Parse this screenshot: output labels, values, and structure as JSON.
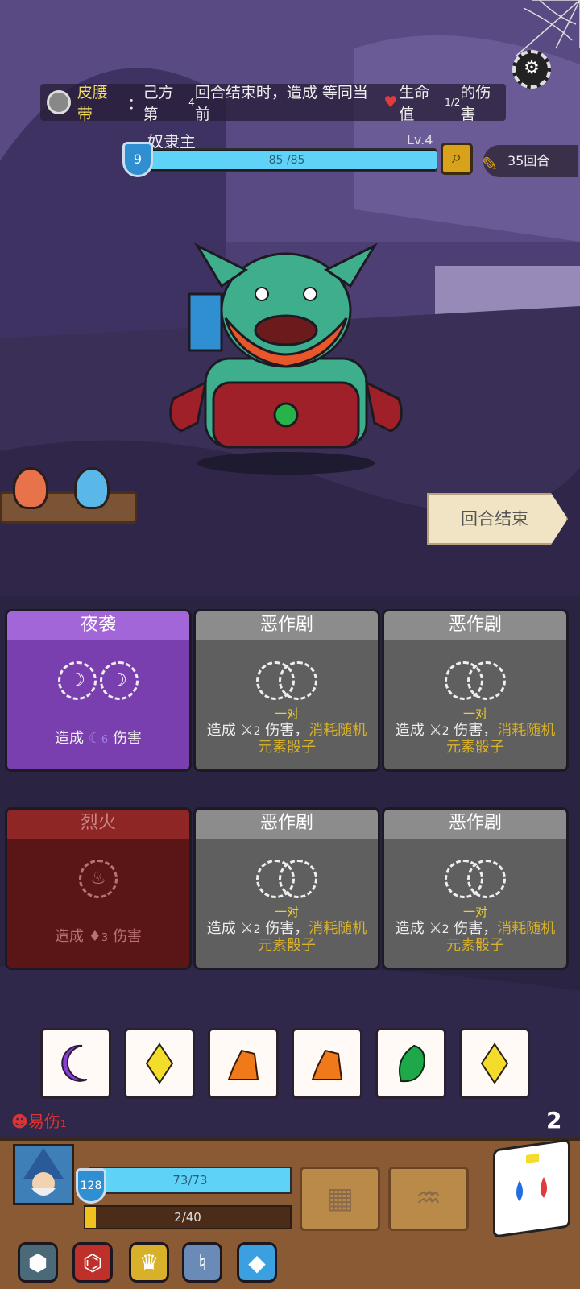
{
  "belt": {
    "name": "皮腰带",
    "sep": "：",
    "text_a": "己方第",
    "num_a": "4",
    "text_b": "回合结束时，造成 等同当前",
    "text_c": "生命值",
    "num_b": "1/2",
    "text_d": " 的伤害"
  },
  "enemy": {
    "name": "奴隶主",
    "level": "Lv.4",
    "shield": "9",
    "hp_text": "85 /85",
    "hp_fraction": 1.0
  },
  "round_label": "35回合",
  "end_turn_label": "回合结束",
  "cards": [
    {
      "title": "夜袭",
      "style": "purple",
      "desc_a": "造成",
      "dmg": "6",
      "desc_b": "伤害"
    },
    {
      "title": "恶作剧",
      "style": "gray",
      "cond": "一对",
      "desc_a": "造成",
      "dmg": "2",
      "desc_b": "伤害，",
      "desc_gold": "消耗随机",
      "desc_gold2": "元素骰子"
    },
    {
      "title": "恶作剧",
      "style": "gray",
      "cond": "一对",
      "desc_a": "造成",
      "dmg": "2",
      "desc_b": "伤害，",
      "desc_gold": "消耗随机",
      "desc_gold2": "元素骰子"
    },
    {
      "title": "烈火",
      "style": "red",
      "desc_a": "造成",
      "dmg": "3",
      "desc_b": "伤害"
    },
    {
      "title": "恶作剧",
      "style": "gray",
      "cond": "一对",
      "desc_a": "造成",
      "dmg": "2",
      "desc_b": "伤害，",
      "desc_gold": "消耗随机",
      "desc_gold2": "元素骰子"
    },
    {
      "title": "恶作剧",
      "style": "gray",
      "cond": "一对",
      "desc_a": "造成",
      "dmg": "2",
      "desc_b": "伤害，",
      "desc_gold": "消耗随机",
      "desc_gold2": "元素骰子"
    }
  ],
  "dice": [
    "moon-die-icon",
    "light-die-icon",
    "fire-die-icon",
    "fire-die-icon",
    "leaf-die-icon",
    "light-die-icon"
  ],
  "status": {
    "label": "易伤",
    "count": "1"
  },
  "dice_left": "2",
  "player": {
    "shield": "128",
    "hp_text": "73/73",
    "hp_fraction": 1.0,
    "xp_text": "2/40",
    "xp_fraction": 0.05
  },
  "colors": {
    "hp": "#5fd3f7",
    "xp": "#f1c21b",
    "gold": "#d8b12a",
    "purple": "#7a3fae"
  }
}
